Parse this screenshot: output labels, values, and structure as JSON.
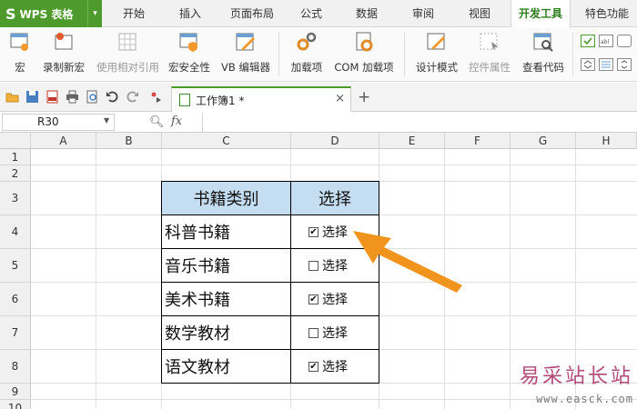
{
  "app": {
    "logo": "S",
    "name": "WPS 表格",
    "caret": "▾"
  },
  "menu": {
    "tabs": [
      "开始",
      "插入",
      "页面布局",
      "公式",
      "数据",
      "审阅",
      "视图",
      "开发工具",
      "特色功能"
    ],
    "active": "开发工具"
  },
  "ribbon": {
    "buttons": [
      {
        "label": "宏",
        "icon": "macro-icon",
        "enabled": true
      },
      {
        "label": "录制新宏",
        "icon": "record-macro-icon",
        "enabled": true
      },
      {
        "label": "使用相对引用",
        "icon": "relative-reference-icon",
        "enabled": false
      },
      {
        "label": "宏安全性",
        "icon": "macro-security-icon",
        "enabled": true
      },
      {
        "label": "VB 编辑器",
        "icon": "vb-editor-icon",
        "enabled": true
      },
      {
        "label": "加载项",
        "icon": "addins-icon",
        "enabled": true
      },
      {
        "label": "COM 加载项",
        "icon": "com-addins-icon",
        "enabled": true
      },
      {
        "label": "设计模式",
        "icon": "design-mode-icon",
        "enabled": true
      },
      {
        "label": "控件属性",
        "icon": "control-properties-icon",
        "enabled": false
      },
      {
        "label": "查看代码",
        "icon": "view-code-icon",
        "enabled": true
      }
    ]
  },
  "workbook_tab": {
    "title": "工作簿1 *",
    "close": "×"
  },
  "new_tab": "+",
  "formula_bar": {
    "cell_ref": "R30",
    "fx": "fx",
    "formula": ""
  },
  "columns": [
    "A",
    "B",
    "C",
    "D",
    "E",
    "F",
    "G",
    "H"
  ],
  "rows": [
    "1",
    "2",
    "3",
    "4",
    "5",
    "6",
    "7",
    "8",
    "9",
    "10"
  ],
  "table": {
    "header": [
      "书籍类别",
      "选择"
    ],
    "rows": [
      {
        "category": "科普书籍",
        "checked": true,
        "label": "选择"
      },
      {
        "category": "音乐书籍",
        "checked": false,
        "label": "选择"
      },
      {
        "category": "美术书籍",
        "checked": true,
        "label": "选择"
      },
      {
        "category": "数学教材",
        "checked": false,
        "label": "选择"
      },
      {
        "category": "语文教材",
        "checked": true,
        "label": "选择"
      }
    ]
  },
  "colors": {
    "accent": "#4e9a2c",
    "header_fill": "#c5ddf1",
    "arrow": "#f0941e"
  },
  "watermark": {
    "text": "易采站长站",
    "url": "www.easck.com"
  }
}
